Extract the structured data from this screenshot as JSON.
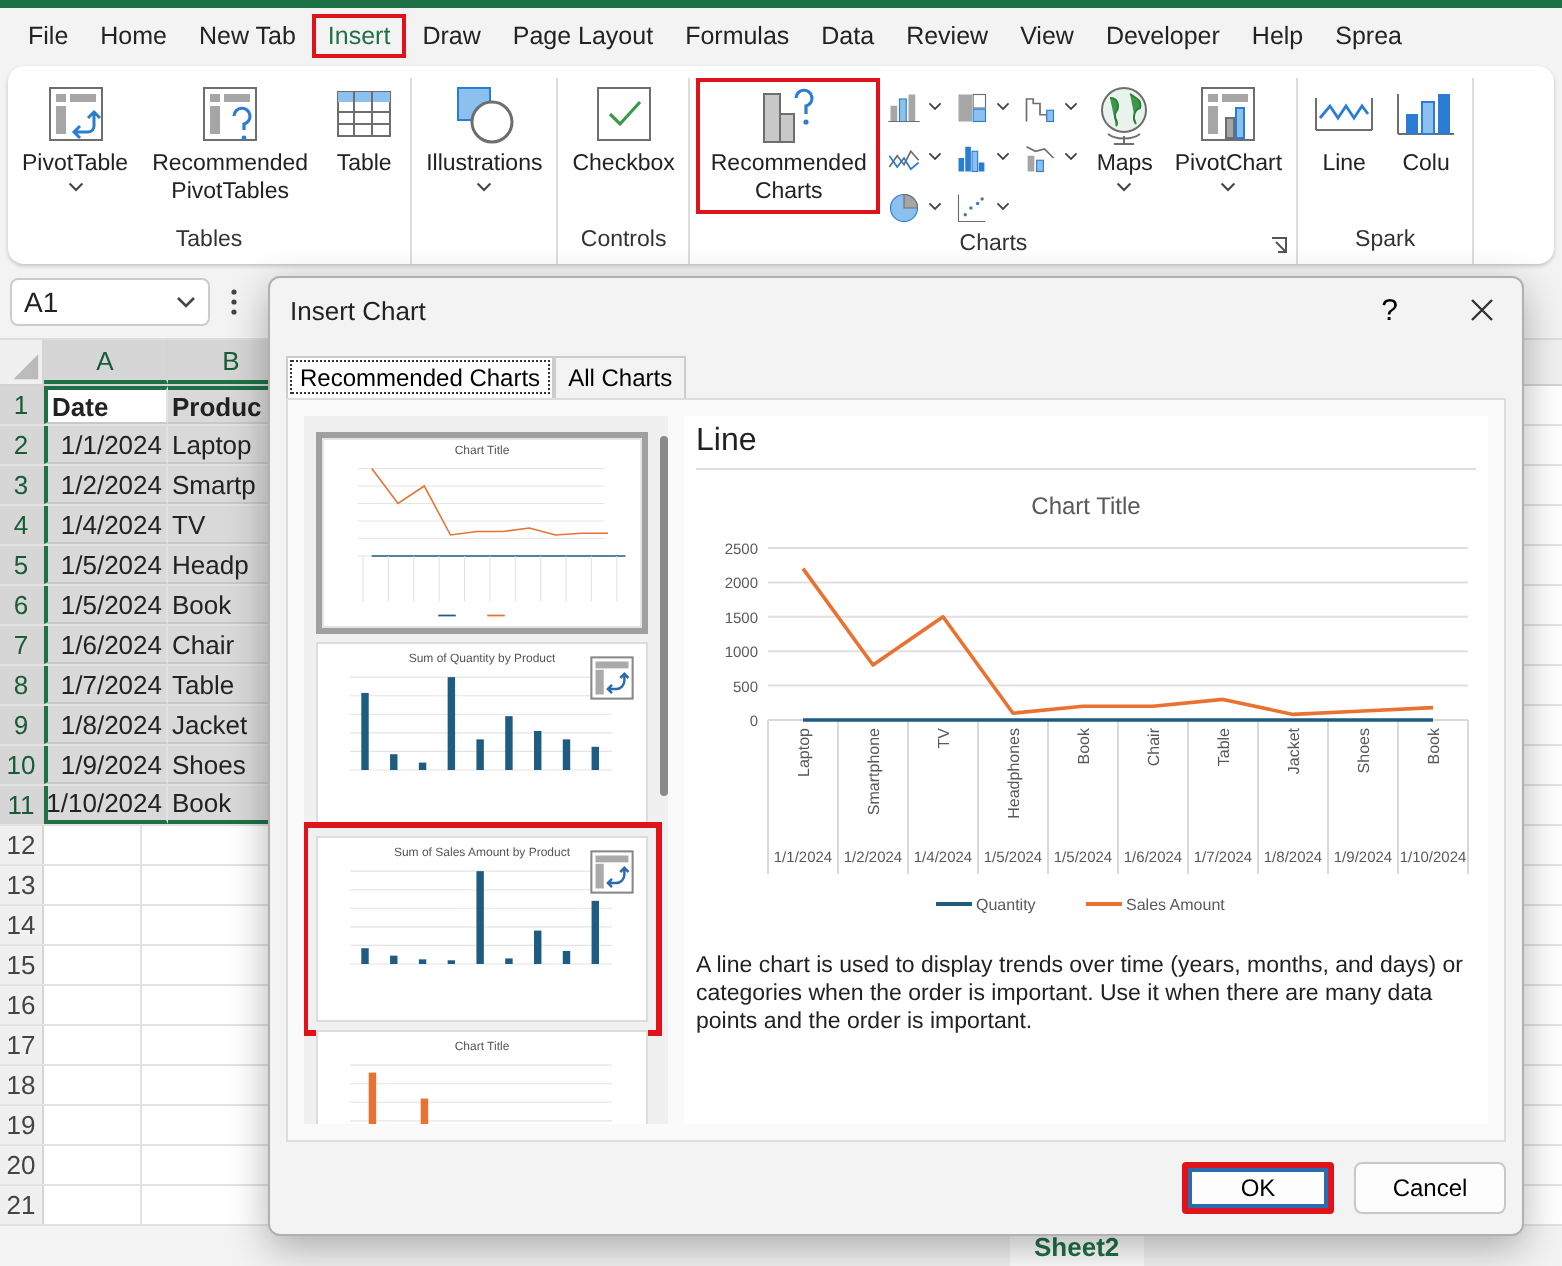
{
  "menu_tabs": [
    {
      "label": "File",
      "selected": false,
      "highlighted": false
    },
    {
      "label": "Home",
      "selected": false,
      "highlighted": false
    },
    {
      "label": "New Tab",
      "selected": false,
      "highlighted": false
    },
    {
      "label": "Insert",
      "selected": true,
      "highlighted": true
    },
    {
      "label": "Draw",
      "selected": false,
      "highlighted": false
    },
    {
      "label": "Page Layout",
      "selected": false,
      "highlighted": false
    },
    {
      "label": "Formulas",
      "selected": false,
      "highlighted": false
    },
    {
      "label": "Data",
      "selected": false,
      "highlighted": false
    },
    {
      "label": "Review",
      "selected": false,
      "highlighted": false
    },
    {
      "label": "View",
      "selected": false,
      "highlighted": false
    },
    {
      "label": "Developer",
      "selected": false,
      "highlighted": false
    },
    {
      "label": "Help",
      "selected": false,
      "highlighted": false
    },
    {
      "label": "Sprea",
      "selected": false,
      "highlighted": false
    }
  ],
  "ribbon": {
    "groups": [
      {
        "label": "Tables",
        "items": [
          {
            "kind": "pivot-table",
            "label": "PivotTable",
            "dropdown": true,
            "highlighted": false
          },
          {
            "kind": "pivot-table-question",
            "label": "Recommended PivotTables",
            "dropdown": false,
            "highlighted": false
          },
          {
            "kind": "table-grid",
            "label": "Table",
            "dropdown": false,
            "highlighted": false
          }
        ]
      },
      {
        "items": [
          {
            "kind": "shapes",
            "label": "Illustrations",
            "dropdown": true,
            "highlighted": false
          }
        ]
      },
      {
        "label": "Controls",
        "items": [
          {
            "kind": "checkmark",
            "label": "Checkbox",
            "dropdown": false,
            "highlighted": false
          }
        ]
      },
      {
        "label": "Charts",
        "launcher": true,
        "items": [
          {
            "kind": "bar-question",
            "label": "Recommended Charts",
            "dropdown": false,
            "highlighted": true
          },
          {
            "kind": "chart-type-grid",
            "buttons": [
              {
                "kind": "column-chart"
              },
              {
                "kind": "line-chart"
              },
              {
                "kind": "pie-chart"
              },
              {
                "kind": "hierarchy-chart"
              },
              {
                "kind": "statistic-chart"
              },
              {
                "kind": "scatter-chart"
              },
              {
                "kind": "waterfall-chart"
              },
              {
                "kind": "combo-chart"
              }
            ]
          },
          {
            "kind": "globe",
            "label": "Maps",
            "dropdown": true,
            "highlighted": false
          },
          {
            "kind": "pivot-chart",
            "label": "PivotChart",
            "dropdown": true,
            "highlighted": false
          }
        ]
      },
      {
        "label": "Spark",
        "items": [
          {
            "kind": "sparkline",
            "label": "Line",
            "dropdown": false,
            "highlighted": false
          },
          {
            "kind": "sparkline-column",
            "label": "Colu",
            "dropdown": false,
            "highlighted": false
          }
        ]
      }
    ]
  },
  "name_box": "A1",
  "sheet": {
    "columns": [
      {
        "label": "A",
        "selected": true
      },
      {
        "label": "B",
        "selected": true
      }
    ],
    "rows": [
      {
        "header": "1",
        "selected": true,
        "kind": "header",
        "cells": [
          {
            "text": "Date",
            "active": true
          },
          {
            "text": "Produc",
            "active": false
          }
        ]
      },
      {
        "header": "2",
        "selected": true,
        "kind": "data",
        "cells": [
          {
            "text": "1/1/2024",
            "active": false
          },
          {
            "text": "Laptop",
            "active": false
          }
        ]
      },
      {
        "header": "3",
        "selected": true,
        "kind": "data",
        "cells": [
          {
            "text": "1/2/2024",
            "active": false
          },
          {
            "text": "Smartp",
            "active": false
          }
        ]
      },
      {
        "header": "4",
        "selected": true,
        "kind": "data",
        "cells": [
          {
            "text": "1/4/2024",
            "active": false
          },
          {
            "text": "TV",
            "active": false
          }
        ]
      },
      {
        "header": "5",
        "selected": true,
        "kind": "data",
        "cells": [
          {
            "text": "1/5/2024",
            "active": false
          },
          {
            "text": "Headp",
            "active": false
          }
        ]
      },
      {
        "header": "6",
        "selected": true,
        "kind": "data",
        "cells": [
          {
            "text": "1/5/2024",
            "active": false
          },
          {
            "text": "Book",
            "active": false
          }
        ]
      },
      {
        "header": "7",
        "selected": true,
        "kind": "data",
        "cells": [
          {
            "text": "1/6/2024",
            "active": false
          },
          {
            "text": "Chair",
            "active": false
          }
        ]
      },
      {
        "header": "8",
        "selected": true,
        "kind": "data",
        "cells": [
          {
            "text": "1/7/2024",
            "active": false
          },
          {
            "text": "Table",
            "active": false
          }
        ]
      },
      {
        "header": "9",
        "selected": true,
        "kind": "data",
        "cells": [
          {
            "text": "1/8/2024",
            "active": false
          },
          {
            "text": "Jacket",
            "active": false
          }
        ]
      },
      {
        "header": "10",
        "selected": true,
        "kind": "data",
        "cells": [
          {
            "text": "1/9/2024",
            "active": false
          },
          {
            "text": "Shoes",
            "active": false
          }
        ]
      },
      {
        "header": "11",
        "selected": true,
        "kind": "data",
        "cells": [
          {
            "text": "1/10/2024",
            "active": false
          },
          {
            "text": "Book",
            "active": false
          }
        ]
      },
      {
        "header": "12",
        "selected": false,
        "kind": "empty"
      },
      {
        "header": "13",
        "selected": false,
        "kind": "empty"
      },
      {
        "header": "14",
        "selected": false,
        "kind": "empty"
      },
      {
        "header": "15",
        "selected": false,
        "kind": "empty"
      },
      {
        "header": "16",
        "selected": false,
        "kind": "empty"
      },
      {
        "header": "17",
        "selected": false,
        "kind": "empty"
      },
      {
        "header": "18",
        "selected": false,
        "kind": "empty"
      },
      {
        "header": "19",
        "selected": false,
        "kind": "empty"
      },
      {
        "header": "20",
        "selected": false,
        "kind": "empty"
      },
      {
        "header": "21",
        "selected": false,
        "kind": "empty"
      }
    ],
    "tabs": [
      {
        "label": "Sheet2",
        "selected": true
      }
    ]
  },
  "dialog": {
    "title": "Insert Chart",
    "help": "?",
    "tabs": [
      {
        "label": "Recommended Charts",
        "selected": true
      },
      {
        "label": "All Charts",
        "selected": false
      }
    ],
    "thumbnails": [
      {
        "title": "Chart Title",
        "kind": "line",
        "selected": true,
        "highlighted": false
      },
      {
        "title": "Sum of Quantity by Product",
        "kind": "bar-quantity",
        "selected": false,
        "highlighted": false
      },
      {
        "title": "Sum of Sales Amount by Product",
        "kind": "bar-sales",
        "selected": false,
        "highlighted": true
      },
      {
        "title": "Chart Title",
        "kind": "clustered",
        "selected": false,
        "highlighted": false
      }
    ],
    "preview": {
      "title": "Line",
      "chart_data": {
        "type": "line",
        "title": "Chart Title",
        "categories": [
          "Laptop",
          "Smartphone",
          "TV",
          "Headphones",
          "Book",
          "Chair",
          "Table",
          "Jacket",
          "Shoes",
          "Book"
        ],
        "series": [
          {
            "name": "Quantity",
            "color": "#1f5c82",
            "values": [
              0,
              0,
              0,
              0,
              0,
              0,
              0,
              0,
              0,
              0
            ]
          },
          {
            "name": "Sales Amount",
            "color": "#e97132",
            "values": [
              2200,
              800,
              1500,
              100,
              200,
              200,
              300,
              80,
              130,
              180
            ]
          }
        ],
        "ylim": [
          0,
          2500
        ],
        "yticks": [
          0,
          500,
          1000,
          1500,
          2000,
          2500
        ],
        "grid": true,
        "legend": true
      },
      "category_dates": [
        "1/1/2024",
        "1/2/2024",
        "1/4/2024",
        "1/5/2024",
        "1/5/2024",
        "1/6/2024",
        "1/7/2024",
        "1/8/2024",
        "1/9/2024",
        "1/10/2024"
      ],
      "description": "A line chart is used to display trends over time (years, months, and days) or categories when the order is important. Use it when there are many data points and the order is important."
    },
    "buttons": [
      {
        "label": "OK",
        "default": true,
        "highlighted": true
      },
      {
        "label": "Cancel",
        "default": false,
        "highlighted": false
      }
    ]
  }
}
